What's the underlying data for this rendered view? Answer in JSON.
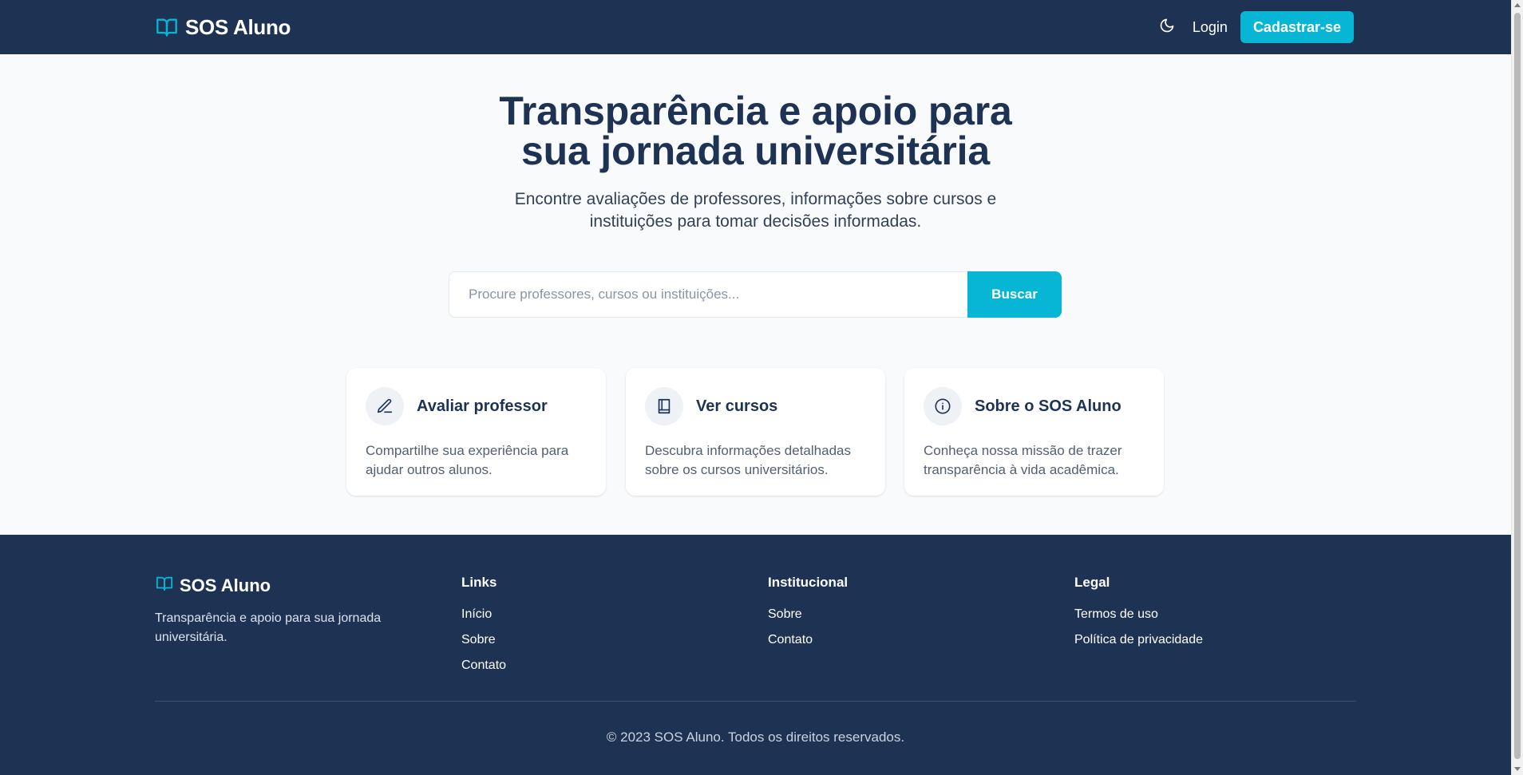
{
  "colors": {
    "navy": "#1e3354",
    "accent": "#06b6d4",
    "background": "#f8fafc",
    "card": "#ffffff"
  },
  "header": {
    "brand": "SOS Aluno",
    "brand_icon": "book-open-icon",
    "theme_toggle_icon": "moon-icon",
    "login_label": "Login",
    "signup_label": "Cadastrar-se"
  },
  "hero": {
    "title_line1": "Transparência e apoio para",
    "title_line2": "sua jornada universitária",
    "subtitle_line1": "Encontre avaliações de professores, informações sobre cursos e",
    "subtitle_line2": "instituições para tomar decisões informadas.",
    "search": {
      "placeholder": "Procure professores, cursos ou instituições...",
      "value": "",
      "button_label": "Buscar"
    }
  },
  "cards": [
    {
      "icon": "pencil-icon",
      "title": "Avaliar professor",
      "desc_line1": "Compartilhe sua experiência para",
      "desc_line2": "ajudar outros alunos."
    },
    {
      "icon": "book-icon",
      "title": "Ver cursos",
      "desc_line1": "Descubra informações detalhadas",
      "desc_line2": "sobre os cursos universitários."
    },
    {
      "icon": "info-icon",
      "title": "Sobre o SOS Aluno",
      "desc_line1": "Conheça nossa missão de trazer",
      "desc_line2": "transparência à vida acadêmica."
    }
  ],
  "footer": {
    "brand": "SOS Aluno",
    "tagline_line1": "Transparência e apoio para sua jornada",
    "tagline_line2": "universitária.",
    "columns": [
      {
        "heading": "Links",
        "items": [
          "Início",
          "Sobre",
          "Contato"
        ]
      },
      {
        "heading": "Institucional",
        "items": [
          "Sobre",
          "Contato"
        ]
      },
      {
        "heading": "Legal",
        "items": [
          "Termos de uso",
          "Política de privacidade"
        ]
      }
    ],
    "copyright": "© 2023 SOS Aluno. Todos os direitos reservados."
  }
}
